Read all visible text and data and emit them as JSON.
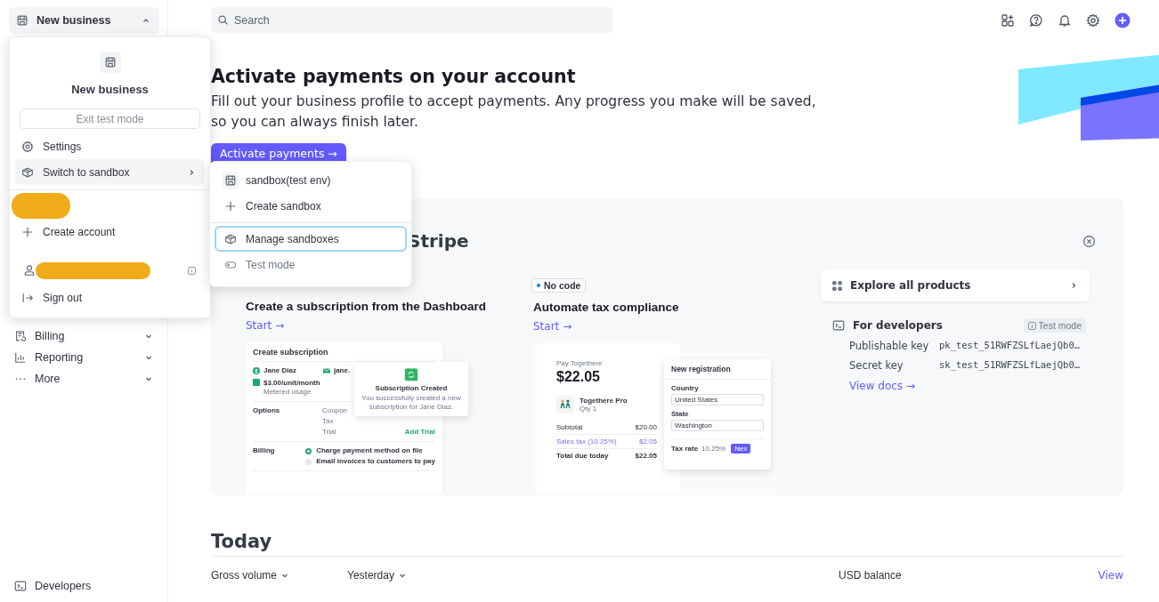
{
  "sidebar": {
    "account": {
      "name": "New business",
      "expanded": true
    },
    "nav": [
      {
        "label": "Billing",
        "kind": "billing",
        "expandable": true
      },
      {
        "label": "Reporting",
        "kind": "reporting",
        "expandable": true
      },
      {
        "label": "More",
        "kind": "more",
        "expandable": true
      }
    ],
    "footer": {
      "label": "Developers"
    }
  },
  "account_menu": {
    "title": "New business",
    "exit_button": "Exit test mode",
    "items": [
      {
        "label": "Settings",
        "kind": "settings",
        "submenu": false,
        "selected": false
      },
      {
        "label": "Switch to sandbox",
        "kind": "sandbox",
        "submenu": true,
        "selected": true
      }
    ],
    "create_account": "Create account",
    "sign_out": "Sign out"
  },
  "submenu": {
    "groups": [
      [
        {
          "label": "sandbox(test env)",
          "kind": "account",
          "focused": false,
          "disabled": false
        },
        {
          "label": "Create sandbox",
          "kind": "create",
          "focused": false,
          "disabled": false
        }
      ],
      [
        {
          "label": "Manage sandboxes",
          "kind": "sandbox",
          "focused": true,
          "disabled": false
        },
        {
          "label": "Test mode",
          "kind": "mode",
          "focused": false,
          "disabled": true
        }
      ]
    ]
  },
  "search": {
    "placeholder": "Search"
  },
  "hero": {
    "title": "Activate payments on your account",
    "text": "Fill out your business profile to accept payments. Any progress you make will be saved, so you can always finish later.",
    "button": "Activate payments →"
  },
  "panel": {
    "title": "Stripe",
    "cards": [
      {
        "title": "Create a subscription from the Dashboard",
        "link": "Start →",
        "illustration": {
          "kind": "subscription",
          "title": "Create subscription",
          "customer": "Jane Diaz",
          "email": "jane.",
          "price": "$3.00/unit/month",
          "price_note": "Metered usage",
          "options_label": "Options",
          "options": [
            "Coupon",
            "Tax",
            "Trial"
          ],
          "trial_action": "Add Trial",
          "billing_label": "Billing",
          "billing_options": [
            {
              "label": "Charge payment method on file",
              "checked": true
            },
            {
              "label": "Email invoices to customers to pay",
              "checked": false
            }
          ],
          "toast": {
            "title": "Subscription Created",
            "text": "You successfully created a new subscription for Jane Diaz."
          }
        }
      },
      {
        "badge": "No code",
        "title": "Automate tax compliance",
        "link": "Start →",
        "illustration": {
          "kind": "tax",
          "merchant": "Pay Togethere",
          "amount": "$22.05",
          "product": "Togethere Pro",
          "qty": "Qty 1",
          "lines": [
            {
              "label": "Subtotal",
              "value": "$20.00",
              "highlight": false
            },
            {
              "label": "Sales tax (10.25%)",
              "value": "$2.05",
              "highlight": true
            },
            {
              "label": "Total due today",
              "value": "$22.05",
              "highlight": false
            }
          ],
          "form": {
            "title": "New registration",
            "fields": [
              {
                "label": "Country",
                "value": "United States"
              },
              {
                "label": "State",
                "value": "Washington"
              }
            ],
            "rate_label": "Tax rate",
            "rate": "10.25%",
            "button": "Nex"
          }
        }
      }
    ],
    "explore": "Explore all products",
    "developers": {
      "title": "For developers",
      "badge": "Test mode",
      "keys": [
        {
          "label": "Publishable key",
          "value": "pk_test_51RWFZSLfLaejQb0…"
        },
        {
          "label": "Secret key",
          "value": "sk_test_51RWFZSLfLaejQb0…"
        }
      ],
      "link": "View docs →"
    }
  },
  "today": {
    "title": "Today",
    "filters": [
      {
        "label": "Gross volume"
      },
      {
        "label": "Yesterday"
      }
    ],
    "balance": "USD balance",
    "link": "View"
  }
}
